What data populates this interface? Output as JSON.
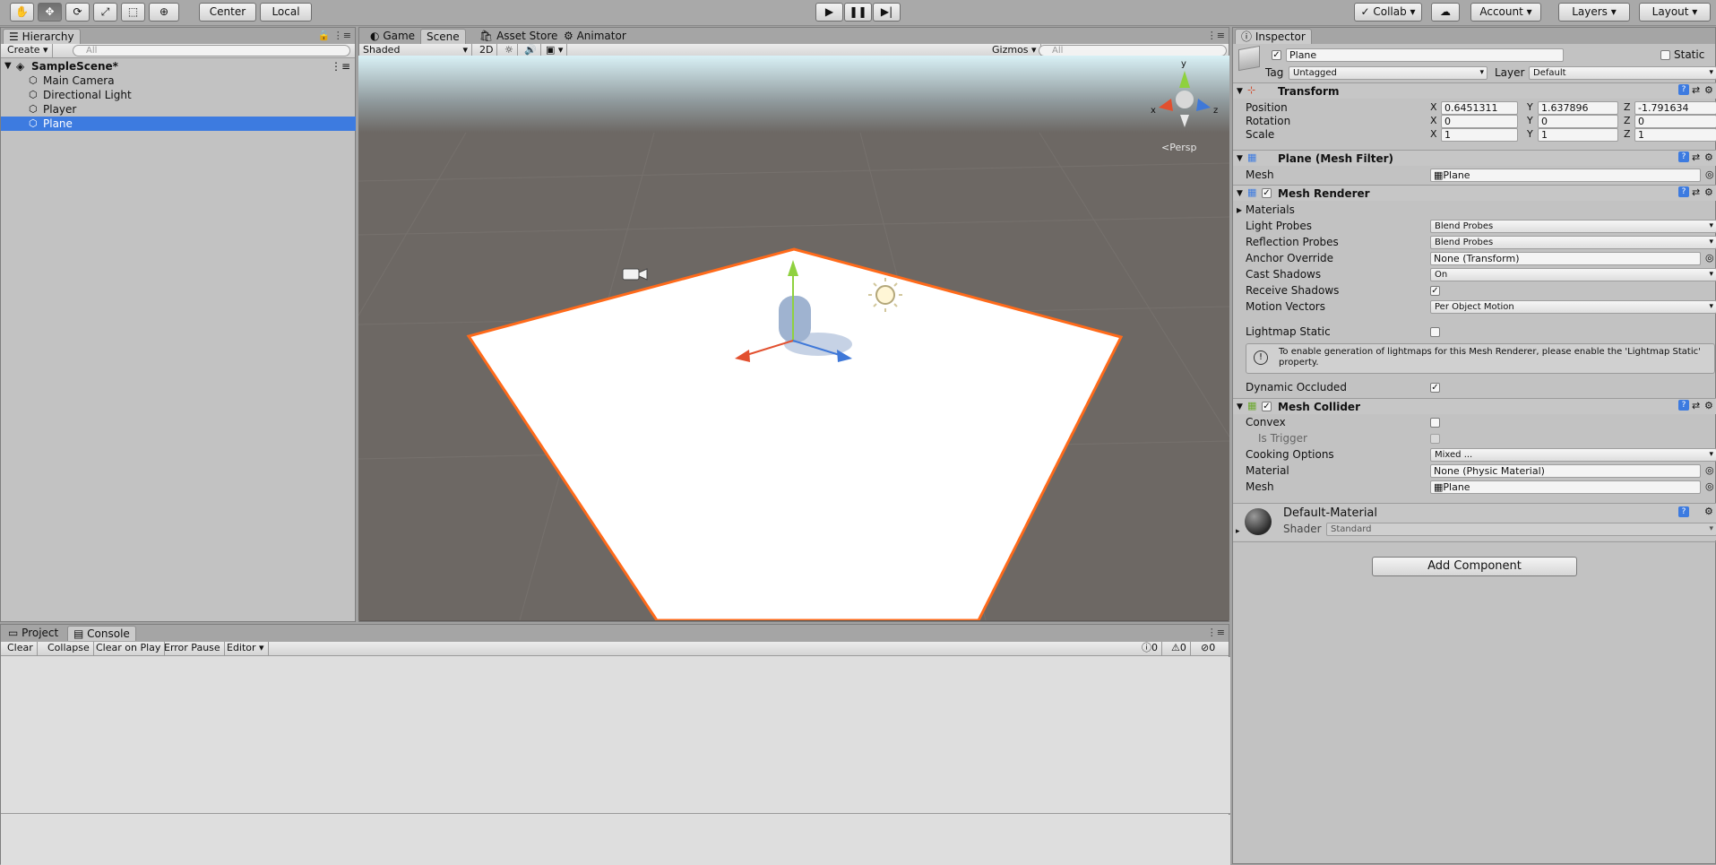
{
  "toolbar": {
    "tools": [
      "hand-tool-icon",
      "move-tool-icon",
      "rotate-tool-icon",
      "scale-tool-icon",
      "rect-tool-icon",
      "transform-tool-icon"
    ],
    "pivot_center": "Center",
    "pivot_local": "Local",
    "collab": "Collab",
    "account": "Account",
    "layers": "Layers",
    "layout": "Layout"
  },
  "hierarchy": {
    "tab": "Hierarchy",
    "create": "Create",
    "search_placeholder": "All",
    "scene": "SampleScene*",
    "items": [
      {
        "label": "Main Camera",
        "selected": false
      },
      {
        "label": "Directional Light",
        "selected": false
      },
      {
        "label": "Player",
        "selected": false
      },
      {
        "label": "Plane",
        "selected": true
      }
    ]
  },
  "scene_view": {
    "tabs": [
      "Game",
      "Scene",
      "Asset Store",
      "Animator"
    ],
    "active_tab": "Scene",
    "shading_mode": "Shaded",
    "mode_2d": "2D",
    "gizmos": "Gizmos",
    "search_placeholder": "All",
    "projection": "Persp",
    "gizmo_axes": {
      "x": "x",
      "y": "y",
      "z": "z"
    }
  },
  "console": {
    "tabs": [
      "Project",
      "Console"
    ],
    "active_tab": "Console",
    "buttons": [
      "Clear",
      "Collapse",
      "Clear on Play",
      "Error Pause",
      "Editor"
    ],
    "counts": {
      "logs": "0",
      "warnings": "0",
      "errors": "0"
    }
  },
  "inspector": {
    "tab": "Inspector",
    "object_name": "Plane",
    "static_label": "Static",
    "tag_label": "Tag",
    "tag_value": "Untagged",
    "layer_label": "Layer",
    "layer_value": "Default",
    "transform": {
      "title": "Transform",
      "position": {
        "label": "Position",
        "x": "0.6451311",
        "y": "1.637896",
        "z": "-1.791634"
      },
      "rotation": {
        "label": "Rotation",
        "x": "0",
        "y": "0",
        "z": "0"
      },
      "scale": {
        "label": "Scale",
        "x": "1",
        "y": "1",
        "z": "1"
      }
    },
    "mesh_filter": {
      "title": "Plane (Mesh Filter)",
      "mesh_label": "Mesh",
      "mesh_value": "Plane"
    },
    "mesh_renderer": {
      "title": "Mesh Renderer",
      "materials": "Materials",
      "light_probes_label": "Light Probes",
      "light_probes": "Blend Probes",
      "reflection_probes_label": "Reflection Probes",
      "reflection_probes": "Blend Probes",
      "anchor_override_label": "Anchor Override",
      "anchor_override": "None (Transform)",
      "cast_shadows_label": "Cast Shadows",
      "cast_shadows": "On",
      "receive_shadows_label": "Receive Shadows",
      "motion_vectors_label": "Motion Vectors",
      "motion_vectors": "Per Object Motion",
      "lightmap_static_label": "Lightmap Static",
      "info": "To enable generation of lightmaps for this Mesh Renderer, please enable the 'Lightmap Static' property.",
      "dynamic_occluded_label": "Dynamic Occluded"
    },
    "mesh_collider": {
      "title": "Mesh Collider",
      "convex_label": "Convex",
      "is_trigger_label": "Is Trigger",
      "cooking_label": "Cooking Options",
      "cooking_value": "Mixed ...",
      "material_label": "Material",
      "material_value": "None (Physic Material)",
      "mesh_label": "Mesh",
      "mesh_value": "Plane"
    },
    "material": {
      "name": "Default-Material",
      "shader_label": "Shader",
      "shader_value": "Standard"
    },
    "add_component": "Add Component"
  }
}
